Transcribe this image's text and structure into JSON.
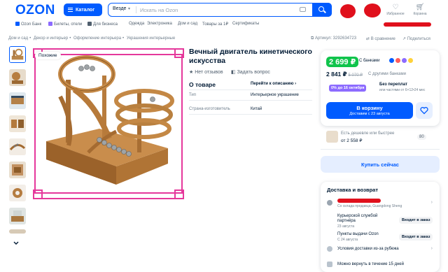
{
  "header": {
    "logo": "OZON",
    "catalog_label": "Каталог",
    "search_scope": "Везде",
    "search_placeholder": "Искать на Ozon",
    "favorites_label": "Избранное",
    "cart_label": "Корзина"
  },
  "subnav": {
    "items": [
      "Ozon Банк",
      "Билеты, отели",
      "Для бизнеса",
      "Одежда",
      "Электроника",
      "Дом и сад",
      "Товары за 1₽",
      "Сертификаты"
    ]
  },
  "breadcrumbs": [
    "Дом и сад",
    "Декор и интерьер",
    "Оформление интерьера",
    "Украшения интерьерные"
  ],
  "meta": {
    "article": "Артикул: 3292634723",
    "compare": "В сравнение",
    "share": "Поделиться"
  },
  "gallery": {
    "similar_label": "Похожие",
    "thumb_count": 8
  },
  "product": {
    "title": "Вечный двигатель кинетического искусства",
    "reviews": "Нет отзывов",
    "ask": "Задать вопрос",
    "about_heading": "О товаре",
    "about_link": "Перейти к описанию",
    "specs": [
      {
        "name": "Тип",
        "value": "Интерьерное украшение"
      },
      {
        "name": "Страна-изготовитель",
        "value": "Китай"
      }
    ]
  },
  "buy_panel": {
    "price_card": "2 699 ₽",
    "price_card_note": "С банками",
    "price_regular": "2 841 ₽",
    "price_old": "5 070 ₽",
    "price_regular_note": "С другими банками",
    "installment_badge": "0% до 16 октября",
    "installment_title": "Без переплат",
    "installment_sub": "или частями от 6×12•24 мес",
    "cart_button": "В корзину",
    "cart_button_sub": "Доставим с 23 августа"
  },
  "cheaper": {
    "line1": "Есть дешевле или быстрее",
    "line2": "от 2 558 ₽",
    "badge": "80"
  },
  "quick_buy": "Купить сейчас",
  "delivery": {
    "heading": "Доставка и возврат",
    "location_sub": "Со склада продавца, Guangdong Sheng",
    "options": [
      {
        "label": "Курьерской службой партнёра",
        "sub": "23 августа",
        "pill": "Входит в заказ"
      },
      {
        "label": "Пункты выдачи Ozon",
        "sub": "С 24 августа",
        "pill": "Входит в заказ"
      }
    ],
    "abroad": "Условия доставки из-за рубежа",
    "return": "Можно вернуть в течение 15 дней"
  },
  "colors": {
    "brand": "#005bff",
    "price_green": "#10c44c",
    "installment": "#8c6bff",
    "redaction": "#e0101c"
  }
}
